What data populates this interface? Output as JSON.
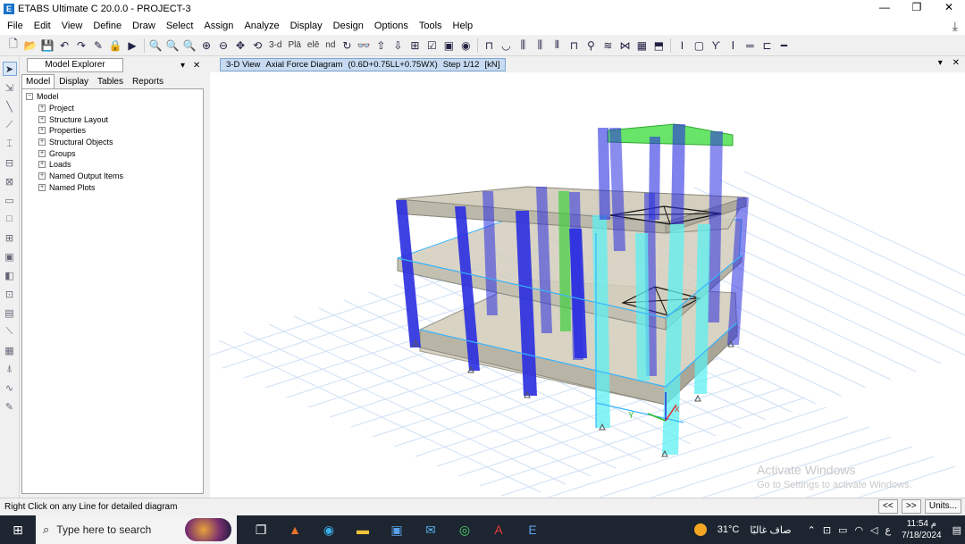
{
  "window": {
    "title": "ETABS Ultimate C 20.0.0 - PROJECT-3",
    "app_icon_letter": "E",
    "controls": [
      "—",
      "❐",
      "✕"
    ]
  },
  "menu": [
    "File",
    "Edit",
    "View",
    "Define",
    "Draw",
    "Select",
    "Assign",
    "Analyze",
    "Display",
    "Design",
    "Options",
    "Tools",
    "Help"
  ],
  "toolbar": {
    "view_3d_label": "3-d",
    "plan_label": "Plā",
    "elev_label": "elē",
    "nd_label": "nd"
  },
  "explorer": {
    "title": "Model Explorer",
    "tabs": [
      "Model",
      "Display",
      "Tables",
      "Reports"
    ],
    "active_tab": "Model",
    "root": "Model",
    "nodes": [
      "Project",
      "Structure Layout",
      "Properties",
      "Structural Objects",
      "Groups",
      "Loads",
      "Named Output Items",
      "Named Plots"
    ]
  },
  "view": {
    "tab_view": "3-D View",
    "tab_diagram": "Axial Force Diagram",
    "tab_combo": "(0.6D+0.75LL+0.75WX)",
    "tab_step": "Step 1/12",
    "tab_units": "[kN]",
    "axis_y": "Y",
    "axis_x": "X"
  },
  "activation": {
    "line1": "Activate Windows",
    "line2": "Go to Settings to activate Windows."
  },
  "status": {
    "text": "Right Click on any Line for detailed diagram",
    "prev": "<<",
    "next": ">>",
    "units": "Units..."
  },
  "taskbar": {
    "search_placeholder": "Type here to search",
    "weather_temp": "31°C",
    "weather_text": "صاف غالبًا",
    "lang": "ع",
    "time": "11:54 م",
    "date": "7/18/2024"
  },
  "colors": {
    "column_dark": "#2a2ee0",
    "column_light": "#5ef0f0",
    "column_green": "#3fcf3f",
    "slab": "#cfc9b4",
    "beam_outline": "#38b6ff",
    "grid": "#cfe0f5"
  }
}
